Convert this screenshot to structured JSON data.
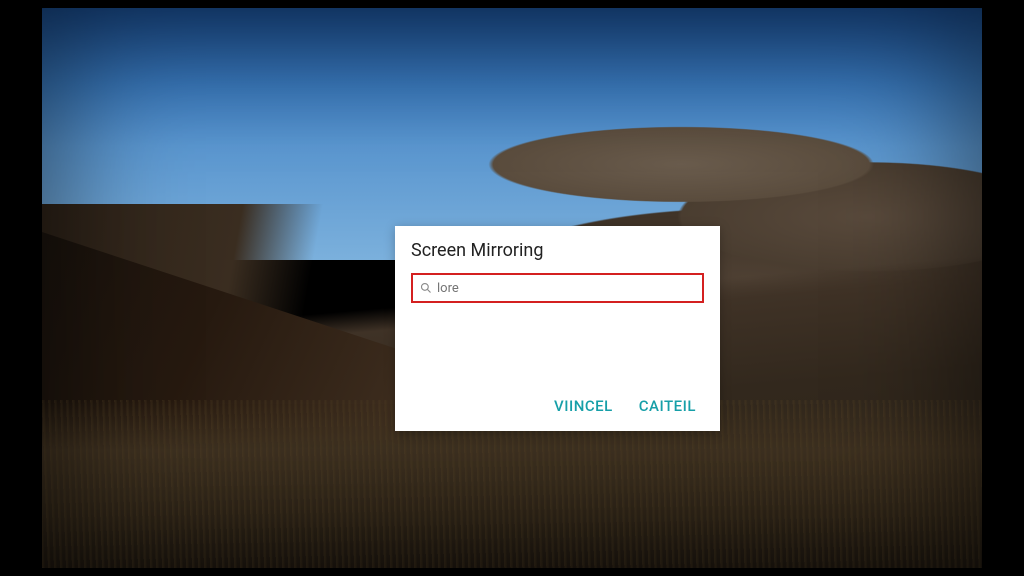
{
  "dialog": {
    "title": "Screen Mirroring",
    "search": {
      "value": "",
      "placeholder": "lore"
    },
    "actions": {
      "left_label": "VIINCEL",
      "right_label": "CAITEIL"
    }
  },
  "colors": {
    "accent": "#169fa8",
    "highlight_border": "#d42020"
  }
}
